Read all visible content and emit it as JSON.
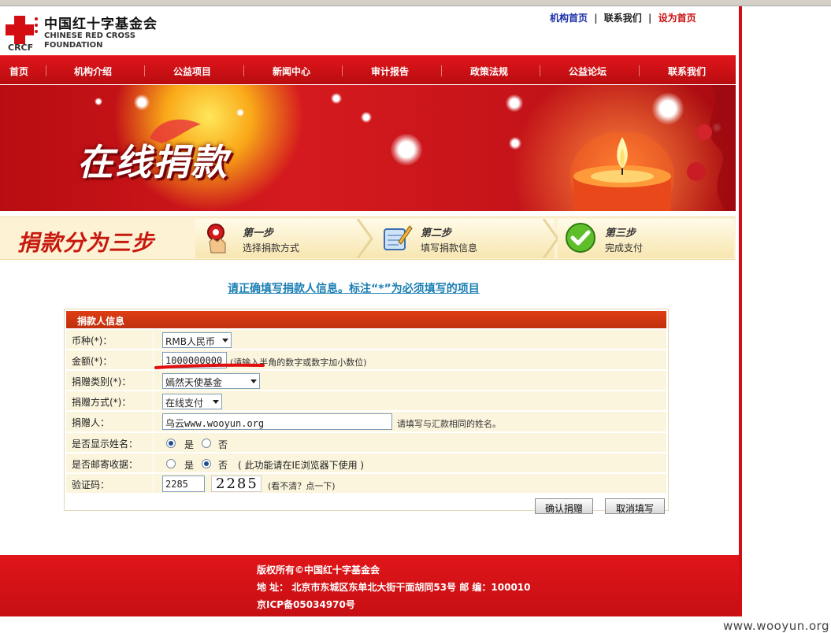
{
  "header": {
    "logo_cn": "中国红十字基金会",
    "logo_en_line1": "CHINESE RED CROSS",
    "logo_en_line2": "FOUNDATION",
    "logo_abbr": "CRCF",
    "links": [
      "机构首页",
      "联系我们",
      "设为首页"
    ],
    "separator": "|"
  },
  "nav": {
    "items": [
      "首页",
      "机构介绍",
      "公益项目",
      "新闻中心",
      "审计报告",
      "政策法规",
      "公益论坛",
      "联系我们"
    ]
  },
  "banner": {
    "title": "在线捐款"
  },
  "steps": {
    "title": "捐款分为三步",
    "items": [
      {
        "name": "第一步",
        "desc": "选择捐款方式"
      },
      {
        "name": "第二步",
        "desc": "填写捐款信息"
      },
      {
        "name": "第三步",
        "desc": "完成支付"
      }
    ]
  },
  "notice": "请正确填写捐款人信息。标注“*”为必须填写的项目",
  "form": {
    "heading": "捐款人信息",
    "currency": {
      "label": "币种(*)：",
      "value": "RMB人民币"
    },
    "amount": {
      "label": "金额(*)：",
      "value": "1000000000",
      "hint": "(请输入半角的数字或数字加小数位)"
    },
    "category": {
      "label": "捐赠类别(*)：",
      "value": "嫣然天使基金"
    },
    "method": {
      "label": "捐赠方式(*)：",
      "value": "在线支付"
    },
    "donor": {
      "label": "捐赠人：",
      "value": "乌云www.wooyun.org",
      "hint": "请填写与汇款相同的姓名。"
    },
    "show_name": {
      "label": "是否显示姓名：",
      "options": [
        "是",
        "否"
      ],
      "selected": "是"
    },
    "mail_receipt": {
      "label": "是否邮寄收据：",
      "options": [
        "是",
        "否"
      ],
      "selected": "否",
      "note": "( 此功能请在IE浏览器下使用 )"
    },
    "captcha": {
      "label": "验证码：",
      "value": "2285",
      "image_text": "2285",
      "refresh": "(看不清？点一下)"
    },
    "submit_label": "确认捐赠",
    "cancel_label": "取消填写"
  },
  "footer": {
    "line1": "版权所有©中国红十字基金会",
    "line2": "地  址：  北京市东城区东单北大街干面胡同53号  邮  编：100010",
    "line3": "京ICP备05034970号"
  },
  "watermark": "www.wooyun.org",
  "colors": {
    "brand_red": "#d40d12",
    "link_blue": "#1a2fa8",
    "notice_blue": "#1b7fb3",
    "form_row": "#fbf5dd",
    "form_head": "#c0300e"
  }
}
